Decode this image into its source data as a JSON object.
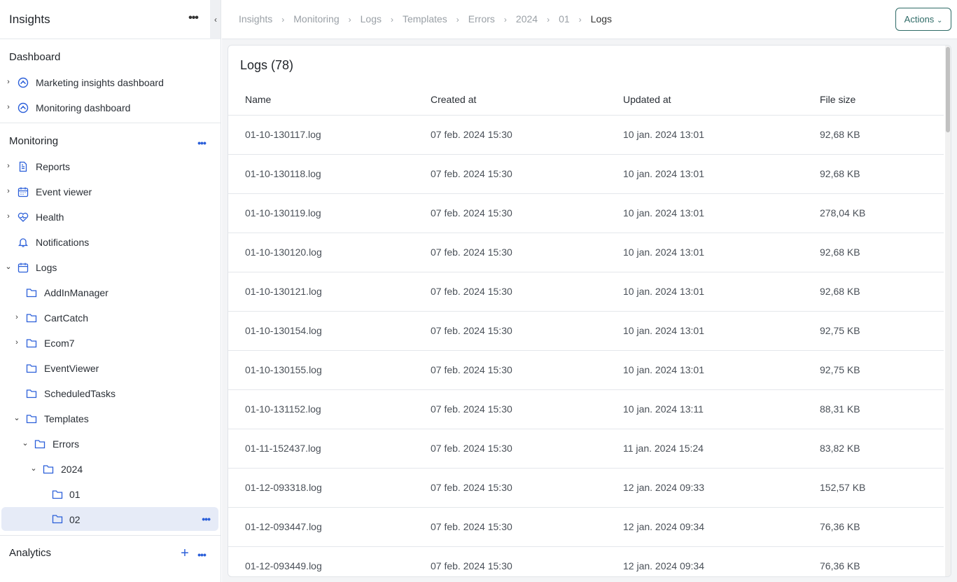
{
  "sidebar": {
    "title": "Insights",
    "dashboard": {
      "title": "Dashboard",
      "items": [
        {
          "label": "Marketing insights dashboard"
        },
        {
          "label": "Monitoring dashboard"
        }
      ]
    },
    "monitoring": {
      "title": "Monitoring",
      "items": [
        {
          "label": "Reports"
        },
        {
          "label": "Event viewer"
        },
        {
          "label": "Health"
        },
        {
          "label": "Notifications"
        },
        {
          "label": "Logs"
        },
        {
          "label": "AddInManager"
        },
        {
          "label": "CartCatch"
        },
        {
          "label": "Ecom7"
        },
        {
          "label": "EventViewer"
        },
        {
          "label": "ScheduledTasks"
        },
        {
          "label": "Templates"
        },
        {
          "label": "Errors"
        },
        {
          "label": "2024"
        },
        {
          "label": "01"
        },
        {
          "label": "02"
        }
      ]
    },
    "analytics": {
      "title": "Analytics"
    }
  },
  "breadcrumb": [
    "Insights",
    "Monitoring",
    "Logs",
    "Templates",
    "Errors",
    "2024",
    "01",
    "Logs"
  ],
  "actions_label": "Actions",
  "panel": {
    "title": "Logs (78)",
    "columns": [
      "Name",
      "Created at",
      "Updated at",
      "File size"
    ],
    "rows": [
      {
        "name": "01-10-130117.log",
        "created": "07 feb. 2024 15:30",
        "updated": "10 jan. 2024 13:01",
        "size": "92,68 KB"
      },
      {
        "name": "01-10-130118.log",
        "created": "07 feb. 2024 15:30",
        "updated": "10 jan. 2024 13:01",
        "size": "92,68 KB"
      },
      {
        "name": "01-10-130119.log",
        "created": "07 feb. 2024 15:30",
        "updated": "10 jan. 2024 13:01",
        "size": "278,04 KB"
      },
      {
        "name": "01-10-130120.log",
        "created": "07 feb. 2024 15:30",
        "updated": "10 jan. 2024 13:01",
        "size": "92,68 KB"
      },
      {
        "name": "01-10-130121.log",
        "created": "07 feb. 2024 15:30",
        "updated": "10 jan. 2024 13:01",
        "size": "92,68 KB"
      },
      {
        "name": "01-10-130154.log",
        "created": "07 feb. 2024 15:30",
        "updated": "10 jan. 2024 13:01",
        "size": "92,75 KB"
      },
      {
        "name": "01-10-130155.log",
        "created": "07 feb. 2024 15:30",
        "updated": "10 jan. 2024 13:01",
        "size": "92,75 KB"
      },
      {
        "name": "01-10-131152.log",
        "created": "07 feb. 2024 15:30",
        "updated": "10 jan. 2024 13:11",
        "size": "88,31 KB"
      },
      {
        "name": "01-11-152437.log",
        "created": "07 feb. 2024 15:30",
        "updated": "11 jan. 2024 15:24",
        "size": "83,82 KB"
      },
      {
        "name": "01-12-093318.log",
        "created": "07 feb. 2024 15:30",
        "updated": "12 jan. 2024 09:33",
        "size": "152,57 KB"
      },
      {
        "name": "01-12-093447.log",
        "created": "07 feb. 2024 15:30",
        "updated": "12 jan. 2024 09:34",
        "size": "76,36 KB"
      },
      {
        "name": "01-12-093449.log",
        "created": "07 feb. 2024 15:30",
        "updated": "12 jan. 2024 09:34",
        "size": "76,36 KB"
      }
    ]
  },
  "colors": {
    "accent": "#2b5fd9",
    "actions_border": "#2f6b67",
    "selected_bg": "#e6ebf7"
  }
}
